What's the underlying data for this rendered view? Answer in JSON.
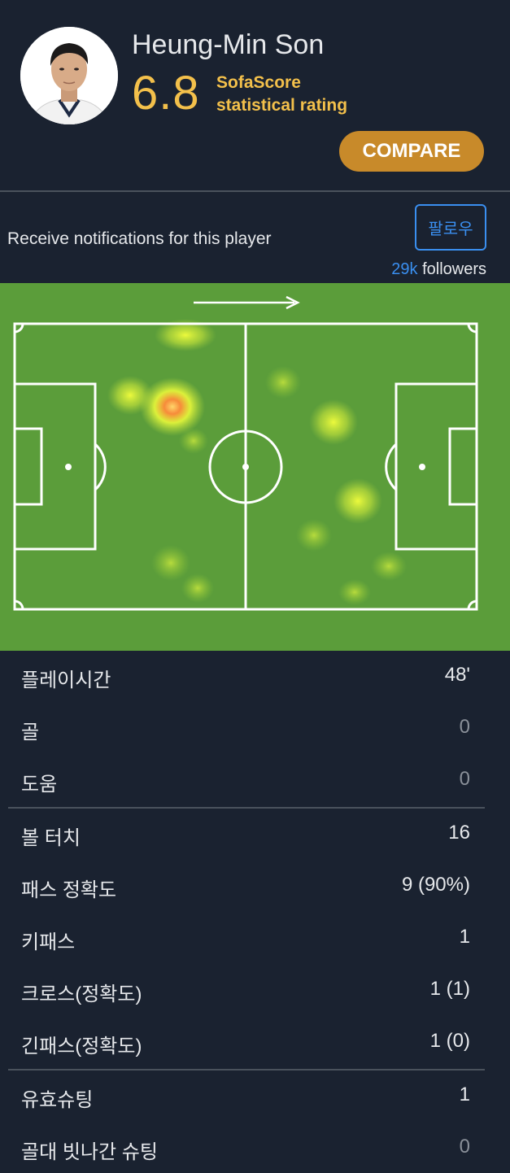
{
  "player": {
    "name": "Heung-Min Son",
    "rating": "6.8",
    "rating_label_line1": "SofaScore",
    "rating_label_line2": "statistical rating",
    "avatar_icon": "player-photo"
  },
  "compare_label": "COMPARE",
  "follow": {
    "notify_text": "Receive notifications for this player",
    "button_label": "팔로우",
    "followers_count": "29k",
    "followers_label": " followers"
  },
  "heatmap": {
    "attack_direction": "right",
    "colors": {
      "pitch": "#5b9d3a",
      "lines": "#ffffff"
    }
  },
  "stats": {
    "group1": [
      {
        "label": "플레이시간",
        "value": "48'",
        "muted": false
      },
      {
        "label": "골",
        "value": "0",
        "muted": true
      },
      {
        "label": "도움",
        "value": "0",
        "muted": true
      }
    ],
    "group2": [
      {
        "label": "볼 터치",
        "value": "16",
        "muted": false
      },
      {
        "label": "패스 정확도",
        "value": "9 (90%)",
        "muted": false
      },
      {
        "label": "키패스",
        "value": "1",
        "muted": false
      },
      {
        "label": "크로스(정확도)",
        "value": "1 (1)",
        "muted": false
      },
      {
        "label": "긴패스(정확도)",
        "value": "1 (0)",
        "muted": false
      }
    ],
    "group3": [
      {
        "label": "유효슈팅",
        "value": "1",
        "muted": false
      },
      {
        "label": "골대 빗나간 슈팅",
        "value": "0",
        "muted": true
      }
    ]
  },
  "colors": {
    "background": "#1a2230",
    "rating": "#f3c04b",
    "compare_button": "#c88a2a",
    "follow_accent": "#3a8ff0",
    "divider": "#4a525c"
  }
}
